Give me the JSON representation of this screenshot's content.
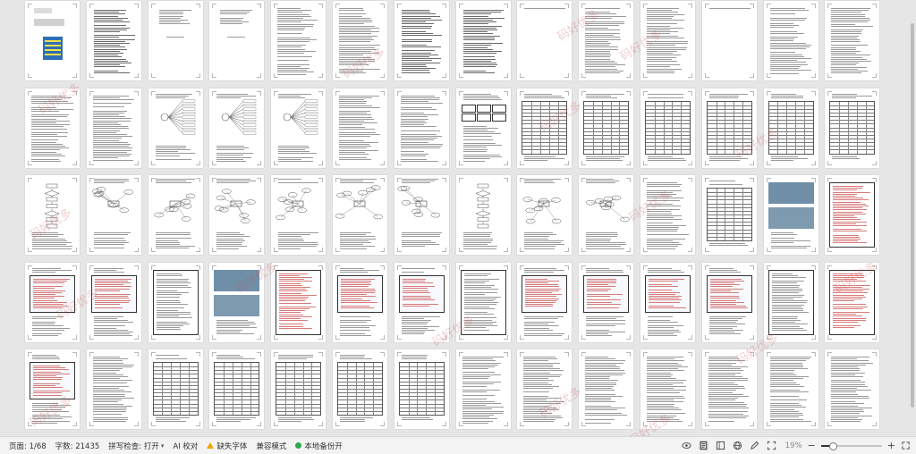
{
  "document": {
    "total_pages": 68,
    "rows": 5,
    "columns": 14,
    "page_kinds": [
      [
        "cover",
        "toc",
        "plain",
        "plain",
        "text",
        "text",
        "toc",
        "toc",
        "blank",
        "text",
        "text",
        "blank",
        "text",
        "text"
      ],
      [
        "text",
        "text",
        "tree",
        "tree",
        "tree",
        "text",
        "text",
        "figure",
        "table",
        "table",
        "table",
        "table",
        "table",
        "table"
      ],
      [
        "flow",
        "diagram",
        "diagram",
        "diagram",
        "diagram",
        "diagram",
        "diagram",
        "flow",
        "diagram",
        "diagram",
        "text",
        "table",
        "photo",
        "code"
      ],
      [
        "ui",
        "ui",
        "code",
        "photo",
        "code",
        "ui",
        "ui",
        "code",
        "ui",
        "ui",
        "ui",
        "ui",
        "code",
        "code"
      ],
      [
        "ui",
        "text",
        "table",
        "table",
        "table",
        "table",
        "table",
        "text",
        "text",
        "text",
        "text",
        "text",
        "text",
        "text"
      ]
    ]
  },
  "watermark": {
    "text": "码好优多",
    "color": "#c85050"
  },
  "statusbar": {
    "page_indicator": "页面: 1/68",
    "word_count": "字数: 21435",
    "spell_check": "拼写检查: 打开",
    "ai_proofread": "AI 校对",
    "missing_fonts": "缺失字体",
    "compat_mode": "兼容模式",
    "local_backup": "本地备份开",
    "zoom": "19%",
    "zoom_fraction": 0.19,
    "icons": [
      "eye-icon",
      "page-view-icon",
      "outline-view-icon",
      "web-view-icon",
      "pen-icon",
      "fit-page-icon"
    ]
  },
  "colors": {
    "canvas": "#e6e6e6",
    "page": "#ffffff",
    "warning": "#f0a400",
    "ok": "#2fa84f",
    "highlight_yellow": "#f4e04d",
    "highlight_blue": "#2e6fb5"
  }
}
